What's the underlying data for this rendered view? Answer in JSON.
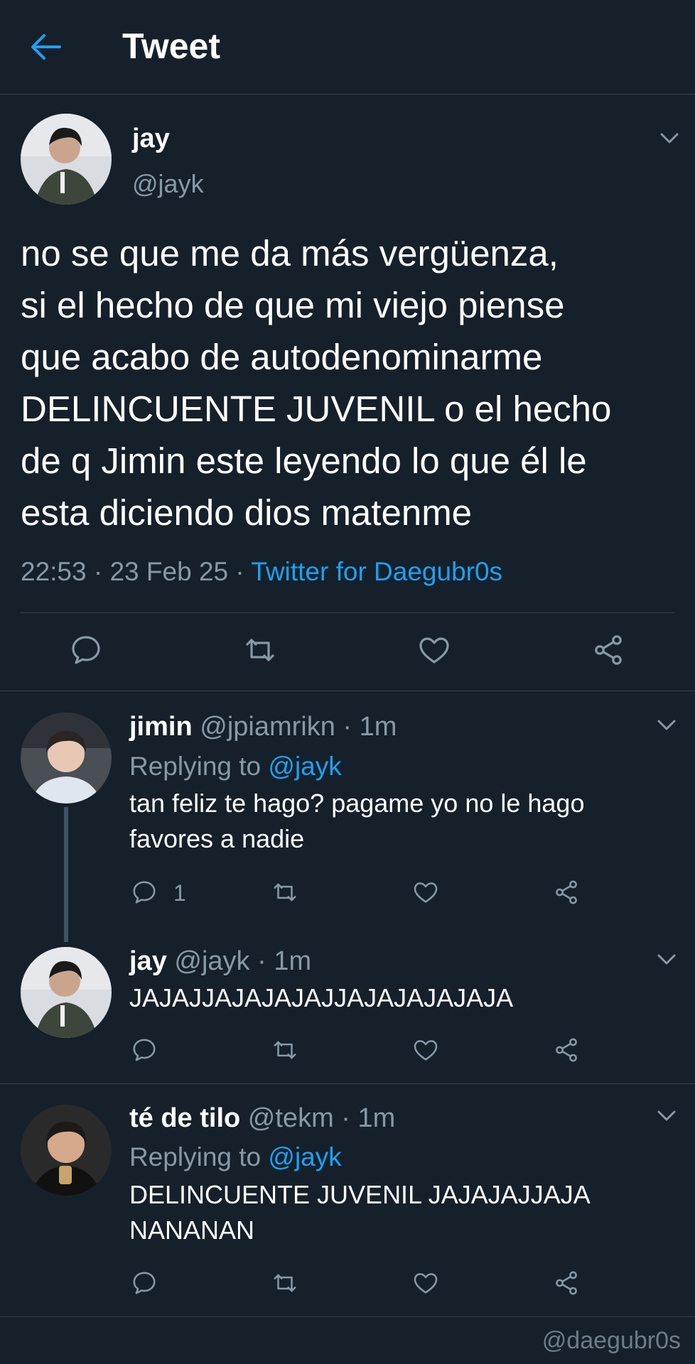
{
  "header": {
    "title": "Tweet"
  },
  "main_tweet": {
    "name": "jay",
    "handle": "@jayk",
    "text": "no se que me da más vergüenza,\nsi el hecho de que mi viejo piense\nque acabo de autodenominarme\nDELINCUENTE JUVENIL o el hecho\nde q Jimin este leyendo lo que él le\nesta diciendo dios matenme",
    "time": "22:53",
    "date": "23 Feb 25",
    "separator": " · ",
    "source": "Twitter for Daegubr0s"
  },
  "replies": [
    {
      "name": "jimin",
      "handle": "@jpiamrikn",
      "age": " · 1m",
      "replying_label": "Replying to ",
      "replying_to": "@jayk",
      "text": "tan feliz te hago? pagame yo no le hago\nfavores a nadie",
      "reply_count": "1"
    },
    {
      "name": "jay",
      "handle": "@jayk",
      "age": " · 1m",
      "text": "JAJAJJAJAJAJAJJAJAJAJAJAJA"
    },
    {
      "name": "té de tilo",
      "handle": "@tekm",
      "age": " · 1m",
      "replying_label": "Replying to ",
      "replying_to": "@jayk",
      "text": "DELINCUENTE JUVENIL JAJAJAJJAJA\nNANANAN"
    }
  ],
  "watermark": "@daegubr0s",
  "colors": {
    "background": "#15202b",
    "accent": "#1da1f2",
    "secondary_text": "#8899a6",
    "divider": "#38444d"
  },
  "icons": [
    "back-arrow-icon",
    "chevron-down-icon",
    "reply-icon",
    "retweet-icon",
    "like-icon",
    "share-icon"
  ]
}
